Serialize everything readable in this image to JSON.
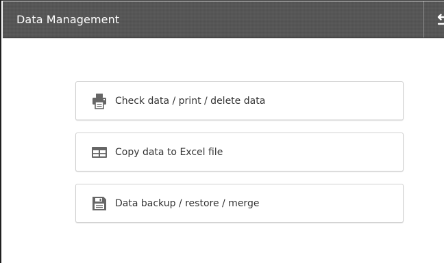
{
  "header": {
    "title": "Data Management",
    "back_icon": "back-arrow-icon"
  },
  "menu": [
    {
      "label": "Check data / print / delete data",
      "icon": "printer-icon"
    },
    {
      "label": "Copy data to Excel file",
      "icon": "table-icon"
    },
    {
      "label": "Data backup / restore / merge",
      "icon": "save-disk-icon"
    }
  ],
  "colors": {
    "header_bg": "#555555",
    "icon": "#666666",
    "text": "#333333",
    "button_border": "#cfcfcf"
  }
}
